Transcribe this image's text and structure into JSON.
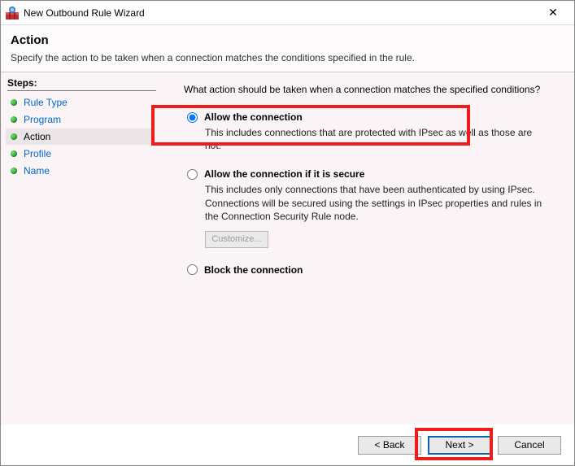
{
  "window": {
    "title": "New Outbound Rule Wizard"
  },
  "header": {
    "title": "Action",
    "subtitle": "Specify the action to be taken when a connection matches the conditions specified in the rule."
  },
  "sidebar": {
    "heading": "Steps:",
    "items": [
      {
        "label": "Rule Type",
        "active": false
      },
      {
        "label": "Program",
        "active": false
      },
      {
        "label": "Action",
        "active": true
      },
      {
        "label": "Profile",
        "active": false
      },
      {
        "label": "Name",
        "active": false
      }
    ]
  },
  "content": {
    "prompt": "What action should be taken when a connection matches the specified conditions?",
    "options": [
      {
        "label": "Allow the connection",
        "desc": "This includes connections that are protected with IPsec as well as those are not.",
        "selected": true
      },
      {
        "label": "Allow the connection if it is secure",
        "desc": "This includes only connections that have been authenticated by using IPsec.  Connections will be secured using the settings in IPsec properties and rules in the Connection Security Rule node.",
        "selected": false
      },
      {
        "label": "Block the connection",
        "desc": "",
        "selected": false
      }
    ],
    "customize_label": "Customize..."
  },
  "footer": {
    "back": "< Back",
    "next": "Next >",
    "cancel": "Cancel"
  }
}
